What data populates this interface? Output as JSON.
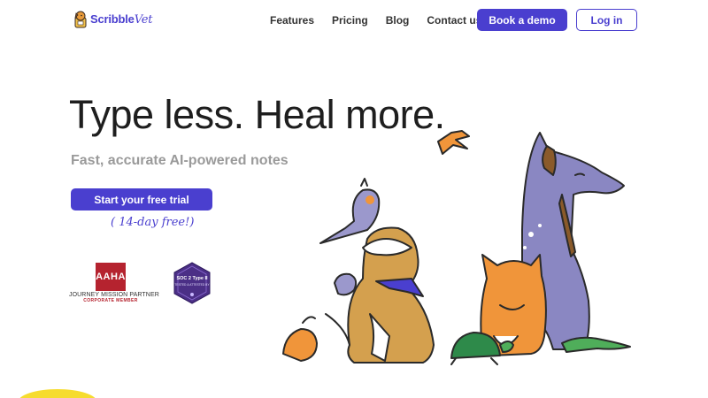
{
  "brand": {
    "name_main": "Scribble",
    "name_accent": "Vet"
  },
  "nav": {
    "links": [
      "Features",
      "Pricing",
      "Blog",
      "Contact us"
    ],
    "demo_label": "Book a demo",
    "login_label": "Log in"
  },
  "hero": {
    "headline": "Type less. Heal more.",
    "subhead": "Fast, accurate AI-powered notes",
    "cta_label": "Start your free trial",
    "cta_note": "( 14-day free!)"
  },
  "badges": {
    "aaha_logo": "AAHA",
    "aaha_line1": "JOURNEY MISSION PARTNER",
    "aaha_line2": "CORPORATE MEMBER",
    "soc_line1": "SOC 2 Type II",
    "soc_line2": "TESTED & ATTESTED BY"
  },
  "colors": {
    "accent": "#4a3fcf",
    "aaha_red": "#b5232f",
    "horse": "#8a87c2",
    "cat": "#f0953a",
    "dog": "#d4a04e"
  },
  "icons": [
    "dog-logo-icon",
    "soc2-badge-icon",
    "pets-illustration"
  ]
}
